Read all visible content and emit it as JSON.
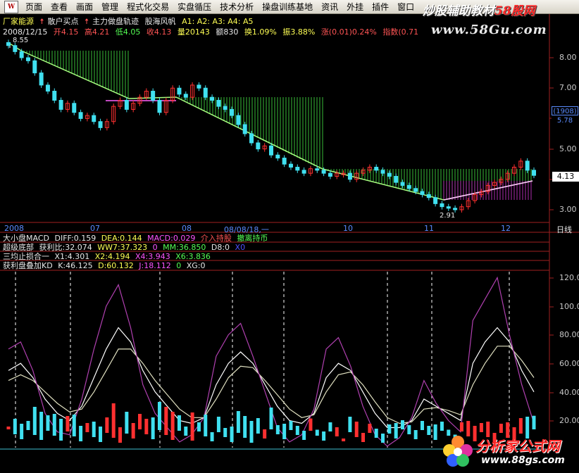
{
  "menu": {
    "items": [
      "页面",
      "查看",
      "画面",
      "管理",
      "程式化交易",
      "实盘循压",
      "技术分析",
      "操盘训练基地",
      "资讯",
      "外挂",
      "插件",
      "窗口"
    ]
  },
  "watermark": {
    "line1_a": "炒股辅助教材",
    "line1_b": "58股网",
    "line2": "www.58Gu.com"
  },
  "title_row": {
    "stock": "厂家能源",
    "ind1": "散户买点",
    "ind2": "主力做盘轨迹",
    "ind3": "股海风帆",
    "lines": "A1: A2: A3: A4: A5"
  },
  "quote_row": {
    "date": "2008/12/15",
    "open": "开4.15",
    "high": "高4.21",
    "low": "低4.05",
    "close": "收4.13",
    "vol": "量20143",
    "amount": "额830",
    "turnover": "换1.09%",
    "amplitude": "振3.88%",
    "change": "涨(0.01)0.24%",
    "index": "指数(0.71"
  },
  "price_axis": [
    "8.00",
    "7.00",
    "6.00",
    "5.00",
    "4.00",
    "3.00"
  ],
  "price_markers": {
    "high_label": "8.55",
    "low_label": "2.91",
    "current": "4.13",
    "count": "(1908)",
    "count_val": "5.78"
  },
  "x_axis": {
    "labels": [
      "2008",
      "07",
      "08",
      "08/08/18,一",
      "10",
      "11",
      "12"
    ],
    "right": "日线"
  },
  "indicators": {
    "macd": {
      "name": "大小盘MACD",
      "diff": "DIFF:0.159",
      "dea": "DEA:0.144",
      "macd": "MACD:0.029",
      "sig1": "介入持股",
      "sig2": "撤离持币"
    },
    "bottom": {
      "name": "超级底部",
      "profit": "获利比:32.074",
      "ww7": "WW7:37.323",
      "zero": "0",
      "mm": "MM:36.850",
      "d8": "D8:0",
      "tail": "X0"
    },
    "stop": {
      "name": "三均止损合一",
      "x1": "X1:4.301",
      "x2": "X2:4.194",
      "x4": "X4:3.943",
      "x6": "X6:3.836"
    },
    "kd": {
      "name": "获利盘叠加KD",
      "k": "K:46.125",
      "d": "D:60.132",
      "j": "J:18.112",
      "zero": "0",
      "xg": "XG:0"
    }
  },
  "kd_axis": [
    "120.00",
    "100.00",
    "80.00",
    "60.00",
    "40.00",
    "20.00"
  ],
  "site_logo": {
    "title": "分析家公式网",
    "url": "www.88gs.com"
  },
  "colors": {
    "up": "#ff3030",
    "down": "#40e0f0",
    "green_fill": "#40d040",
    "magenta": "#c030c0",
    "k_line": "#ffffff",
    "j_line": "#b040b0"
  },
  "chart_data": [
    {
      "type": "candlestick",
      "x_range": [
        "2008-06",
        "2008-12-15"
      ],
      "ylim": [
        2.8,
        8.6
      ],
      "series": [
        {
          "values": [
            8.4,
            8.2,
            8.0,
            7.9,
            7.5,
            7.1,
            6.9,
            6.6,
            6.3,
            6.5,
            6.2,
            6.0,
            6.1,
            5.9,
            5.7,
            5.9,
            6.4,
            6.6,
            6.3,
            6.5,
            6.7,
            6.9,
            6.6,
            6.2,
            6.6,
            7.0,
            6.8,
            6.7,
            7.1,
            7.0,
            6.7,
            6.6,
            6.4,
            6.3,
            6.1,
            5.8,
            5.5,
            5.2,
            5.0,
            5.1,
            4.8,
            4.7,
            4.5,
            4.4,
            4.3,
            4.2,
            4.35,
            4.3,
            4.2,
            4.1,
            4.2,
            4.2,
            4.0,
            4.2,
            4.3,
            4.4,
            4.3,
            4.2,
            4.1,
            3.9,
            3.8,
            3.7,
            3.6,
            3.5,
            3.4,
            3.2,
            3.1,
            3.05,
            3.0,
            3.1,
            3.3,
            3.5,
            3.6,
            3.8,
            3.9,
            4.0,
            4.2,
            4.4,
            4.6,
            4.3,
            4.13
          ]
        }
      ]
    },
    {
      "type": "line",
      "ylim": [
        0,
        125
      ],
      "series": [
        {
          "name": "K",
          "values": [
            55,
            60,
            50,
            35,
            25,
            20,
            30,
            50,
            70,
            85,
            75,
            55,
            40,
            30,
            20,
            18,
            22,
            45,
            60,
            68,
            60,
            45,
            30,
            20,
            18,
            25,
            50,
            60,
            55,
            40,
            25,
            15,
            15,
            20,
            35,
            30,
            25,
            20,
            60,
            75,
            85,
            75,
            55,
            40
          ]
        },
        {
          "name": "D",
          "values": [
            48,
            52,
            48,
            40,
            32,
            26,
            28,
            40,
            55,
            70,
            70,
            60,
            48,
            38,
            28,
            22,
            22,
            35,
            50,
            58,
            57,
            48,
            38,
            28,
            22,
            24,
            40,
            52,
            54,
            45,
            33,
            22,
            18,
            19,
            28,
            29,
            27,
            24,
            45,
            60,
            72,
            72,
            62,
            50
          ]
        },
        {
          "name": "J",
          "values": [
            70,
            75,
            55,
            25,
            12,
            10,
            35,
            70,
            100,
            115,
            85,
            45,
            25,
            15,
            5,
            10,
            22,
            65,
            80,
            88,
            65,
            40,
            15,
            5,
            10,
            28,
            70,
            78,
            58,
            30,
            10,
            2,
            8,
            22,
            48,
            32,
            20,
            12,
            90,
            105,
            120,
            80,
            45,
            18
          ]
        }
      ]
    }
  ]
}
